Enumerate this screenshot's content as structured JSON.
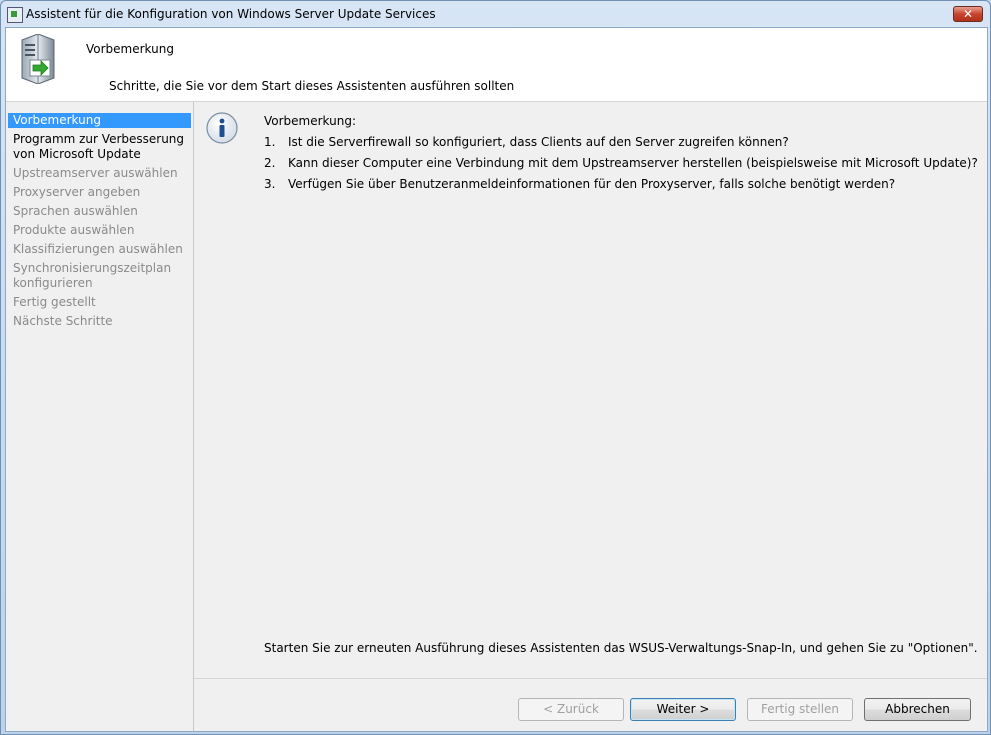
{
  "window": {
    "title": "Assistent für die Konfiguration von Windows Server Update Services",
    "close_glyph": "✕"
  },
  "header": {
    "title": "Vorbemerkung",
    "subtitle": "Schritte, die Sie vor dem Start dieses Assistenten ausführen sollten"
  },
  "sidebar": {
    "items": [
      {
        "label": "Vorbemerkung",
        "state": "active"
      },
      {
        "label": "Programm zur Verbesserung von Microsoft Update",
        "state": "enabled"
      },
      {
        "label": "Upstreamserver auswählen",
        "state": "disabled"
      },
      {
        "label": "Proxyserver angeben",
        "state": "disabled"
      },
      {
        "label": "Sprachen auswählen",
        "state": "disabled"
      },
      {
        "label": "Produkte auswählen",
        "state": "disabled"
      },
      {
        "label": "Klassifizierungen auswählen",
        "state": "disabled"
      },
      {
        "label": "Synchronisierungszeitplan konfigurieren",
        "state": "disabled"
      },
      {
        "label": "Fertig gestellt",
        "state": "disabled"
      },
      {
        "label": "Nächste Schritte",
        "state": "disabled"
      }
    ]
  },
  "content": {
    "intro_label": "Vorbemerkung:",
    "steps": [
      {
        "num": "1.",
        "text": "Ist die Serverfirewall so konfiguriert, dass Clients auf den Server zugreifen können?"
      },
      {
        "num": "2.",
        "text": "Kann dieser Computer eine Verbindung mit dem Upstreamserver herstellen (beispielsweise mit Microsoft Update)?"
      },
      {
        "num": "3.",
        "text": "Verfügen Sie über Benutzeranmeldeinformationen für den Proxyserver, falls solche benötigt werden?"
      }
    ],
    "footer_note": "Starten Sie zur erneuten Ausführung dieses Assistenten das WSUS-Verwaltungs-Snap-In, und gehen Sie zu \"Optionen\"."
  },
  "buttons": {
    "back": "< Zurück",
    "next": "Weiter >",
    "finish": "Fertig stellen",
    "cancel": "Abbrechen"
  }
}
